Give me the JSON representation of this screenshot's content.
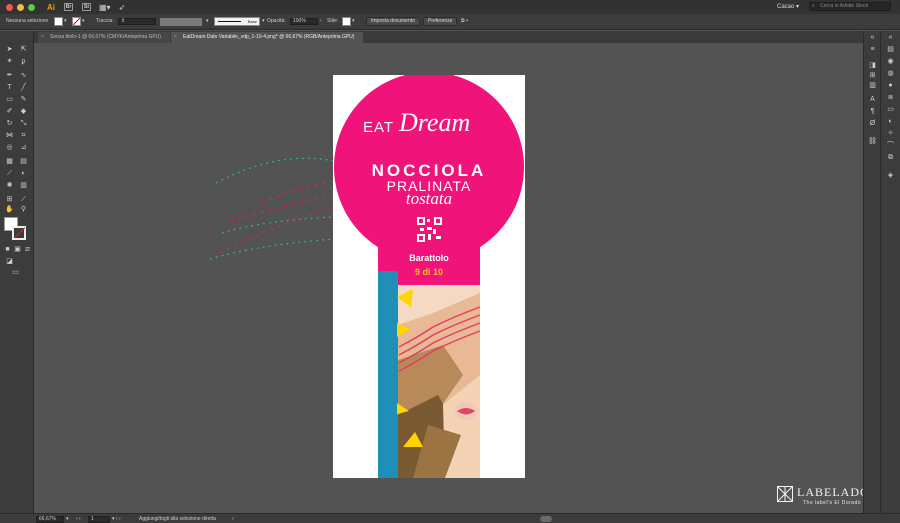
{
  "app": {
    "logo": "Ai",
    "workspace": "Cacao",
    "stock_search_placeholder": "Cerca in Adobe Stock",
    "switcher_br": "Br",
    "switcher_st": "St"
  },
  "control_bar": {
    "selection_label": "Nessuna selezione",
    "stroke_label": "Traccia:",
    "brush_label": "Base",
    "opacity_label": "Opacità:",
    "opacity_value": "100%",
    "style_label": "Stile:",
    "doc_setup_button": "Imposta documento",
    "prefs_button": "Preferenze"
  },
  "tabs": [
    {
      "label": "Senza titolo-1 @ 66,67% (CMYK/Anteprima GPU)"
    },
    {
      "label": "EatDream Dato Variabile_vdp_1-10-4.png* @ 66,67% (RGB/Anteprima GPU)"
    }
  ],
  "artwork": {
    "brand_eat": "EAT",
    "brand_dream": "Dream",
    "product_line1": "NOCCIOLA",
    "product_line2": "PRALINATA",
    "product_line3": "tostata",
    "jar_label": "Barattolo",
    "jar_count": "9 di 10",
    "colors": {
      "magenta": "#f0147a",
      "teal": "#1f8fb8",
      "yellow": "#ffd400",
      "gold": "#f7c21a"
    }
  },
  "status_bar": {
    "zoom": "66,67%",
    "page": "1",
    "hint": "Aggiungi/togli alla selezione diretta"
  },
  "watermark": {
    "name": "LABELADO",
    "tagline": "The label's El Dorado"
  }
}
